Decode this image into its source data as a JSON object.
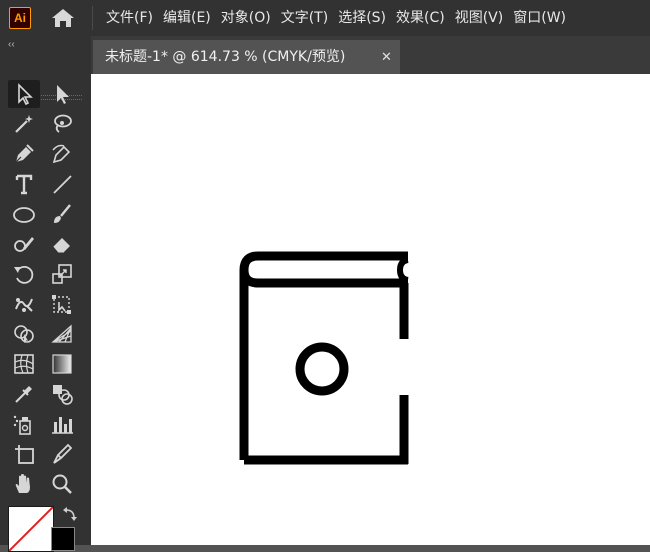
{
  "app": {
    "logo_text": "Ai",
    "brand_color": "#ff9a00"
  },
  "menu": [
    "文件(F)",
    "编辑(E)",
    "对象(O)",
    "文字(T)",
    "选择(S)",
    "效果(C)",
    "视图(V)",
    "窗口(W)"
  ],
  "panel": {
    "collapse_glyph": "‹‹"
  },
  "tabs": [
    {
      "title": "未标题-1* @ 614.73 % (CMYK/预览)",
      "close_glyph": "✕"
    }
  ],
  "tools": [
    {
      "name": "selection-tool-icon",
      "active": true
    },
    {
      "name": "direct-selection-tool-icon"
    },
    {
      "name": "magic-wand-tool-icon"
    },
    {
      "name": "lasso-tool-icon"
    },
    {
      "name": "pen-tool-icon"
    },
    {
      "name": "curvature-tool-icon"
    },
    {
      "name": "type-tool-icon"
    },
    {
      "name": "line-segment-tool-icon"
    },
    {
      "name": "ellipse-tool-icon"
    },
    {
      "name": "paintbrush-tool-icon"
    },
    {
      "name": "shaper-tool-icon"
    },
    {
      "name": "eraser-tool-icon"
    },
    {
      "name": "rotate-tool-icon"
    },
    {
      "name": "scale-tool-icon"
    },
    {
      "name": "puppet-warp-tool-icon"
    },
    {
      "name": "free-transform-tool-icon"
    },
    {
      "name": "shape-builder-tool-icon"
    },
    {
      "name": "perspective-grid-tool-icon"
    },
    {
      "name": "mesh-tool-icon"
    },
    {
      "name": "gradient-tool-icon"
    },
    {
      "name": "eyedropper-tool-icon"
    },
    {
      "name": "blend-tool-icon"
    },
    {
      "name": "symbol-sprayer-tool-icon"
    },
    {
      "name": "column-graph-tool-icon"
    },
    {
      "name": "artboard-tool-icon"
    },
    {
      "name": "slice-tool-icon"
    },
    {
      "name": "hand-tool-icon"
    },
    {
      "name": "zoom-tool-icon"
    }
  ],
  "colors": {
    "fill": "#ffffff",
    "stroke": "#000000",
    "none_slash": "#e02020"
  }
}
